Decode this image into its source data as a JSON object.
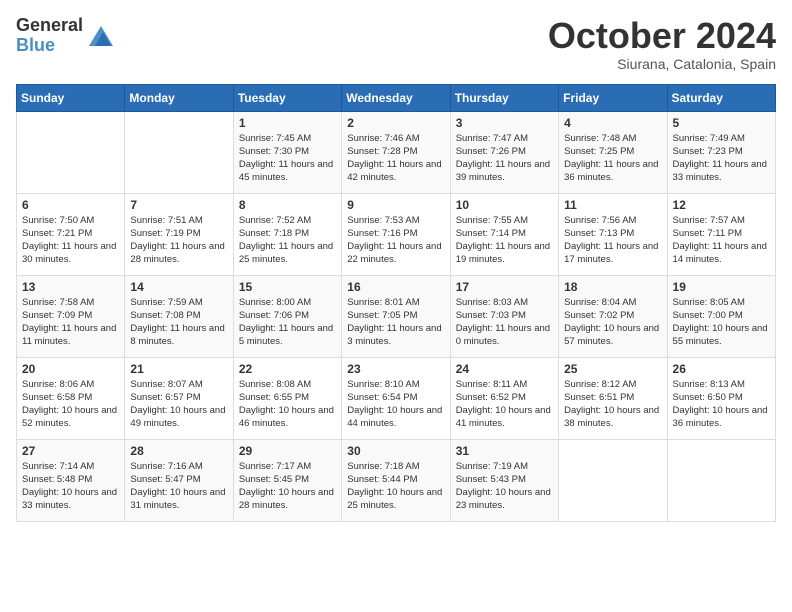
{
  "header": {
    "logo_general": "General",
    "logo_blue": "Blue",
    "month": "October 2024",
    "location": "Siurana, Catalonia, Spain"
  },
  "weekdays": [
    "Sunday",
    "Monday",
    "Tuesday",
    "Wednesday",
    "Thursday",
    "Friday",
    "Saturday"
  ],
  "weeks": [
    [
      {
        "day": "",
        "info": ""
      },
      {
        "day": "",
        "info": ""
      },
      {
        "day": "1",
        "info": "Sunrise: 7:45 AM\nSunset: 7:30 PM\nDaylight: 11 hours and 45 minutes."
      },
      {
        "day": "2",
        "info": "Sunrise: 7:46 AM\nSunset: 7:28 PM\nDaylight: 11 hours and 42 minutes."
      },
      {
        "day": "3",
        "info": "Sunrise: 7:47 AM\nSunset: 7:26 PM\nDaylight: 11 hours and 39 minutes."
      },
      {
        "day": "4",
        "info": "Sunrise: 7:48 AM\nSunset: 7:25 PM\nDaylight: 11 hours and 36 minutes."
      },
      {
        "day": "5",
        "info": "Sunrise: 7:49 AM\nSunset: 7:23 PM\nDaylight: 11 hours and 33 minutes."
      }
    ],
    [
      {
        "day": "6",
        "info": "Sunrise: 7:50 AM\nSunset: 7:21 PM\nDaylight: 11 hours and 30 minutes."
      },
      {
        "day": "7",
        "info": "Sunrise: 7:51 AM\nSunset: 7:19 PM\nDaylight: 11 hours and 28 minutes."
      },
      {
        "day": "8",
        "info": "Sunrise: 7:52 AM\nSunset: 7:18 PM\nDaylight: 11 hours and 25 minutes."
      },
      {
        "day": "9",
        "info": "Sunrise: 7:53 AM\nSunset: 7:16 PM\nDaylight: 11 hours and 22 minutes."
      },
      {
        "day": "10",
        "info": "Sunrise: 7:55 AM\nSunset: 7:14 PM\nDaylight: 11 hours and 19 minutes."
      },
      {
        "day": "11",
        "info": "Sunrise: 7:56 AM\nSunset: 7:13 PM\nDaylight: 11 hours and 17 minutes."
      },
      {
        "day": "12",
        "info": "Sunrise: 7:57 AM\nSunset: 7:11 PM\nDaylight: 11 hours and 14 minutes."
      }
    ],
    [
      {
        "day": "13",
        "info": "Sunrise: 7:58 AM\nSunset: 7:09 PM\nDaylight: 11 hours and 11 minutes."
      },
      {
        "day": "14",
        "info": "Sunrise: 7:59 AM\nSunset: 7:08 PM\nDaylight: 11 hours and 8 minutes."
      },
      {
        "day": "15",
        "info": "Sunrise: 8:00 AM\nSunset: 7:06 PM\nDaylight: 11 hours and 5 minutes."
      },
      {
        "day": "16",
        "info": "Sunrise: 8:01 AM\nSunset: 7:05 PM\nDaylight: 11 hours and 3 minutes."
      },
      {
        "day": "17",
        "info": "Sunrise: 8:03 AM\nSunset: 7:03 PM\nDaylight: 11 hours and 0 minutes."
      },
      {
        "day": "18",
        "info": "Sunrise: 8:04 AM\nSunset: 7:02 PM\nDaylight: 10 hours and 57 minutes."
      },
      {
        "day": "19",
        "info": "Sunrise: 8:05 AM\nSunset: 7:00 PM\nDaylight: 10 hours and 55 minutes."
      }
    ],
    [
      {
        "day": "20",
        "info": "Sunrise: 8:06 AM\nSunset: 6:58 PM\nDaylight: 10 hours and 52 minutes."
      },
      {
        "day": "21",
        "info": "Sunrise: 8:07 AM\nSunset: 6:57 PM\nDaylight: 10 hours and 49 minutes."
      },
      {
        "day": "22",
        "info": "Sunrise: 8:08 AM\nSunset: 6:55 PM\nDaylight: 10 hours and 46 minutes."
      },
      {
        "day": "23",
        "info": "Sunrise: 8:10 AM\nSunset: 6:54 PM\nDaylight: 10 hours and 44 minutes."
      },
      {
        "day": "24",
        "info": "Sunrise: 8:11 AM\nSunset: 6:52 PM\nDaylight: 10 hours and 41 minutes."
      },
      {
        "day": "25",
        "info": "Sunrise: 8:12 AM\nSunset: 6:51 PM\nDaylight: 10 hours and 38 minutes."
      },
      {
        "day": "26",
        "info": "Sunrise: 8:13 AM\nSunset: 6:50 PM\nDaylight: 10 hours and 36 minutes."
      }
    ],
    [
      {
        "day": "27",
        "info": "Sunrise: 7:14 AM\nSunset: 5:48 PM\nDaylight: 10 hours and 33 minutes."
      },
      {
        "day": "28",
        "info": "Sunrise: 7:16 AM\nSunset: 5:47 PM\nDaylight: 10 hours and 31 minutes."
      },
      {
        "day": "29",
        "info": "Sunrise: 7:17 AM\nSunset: 5:45 PM\nDaylight: 10 hours and 28 minutes."
      },
      {
        "day": "30",
        "info": "Sunrise: 7:18 AM\nSunset: 5:44 PM\nDaylight: 10 hours and 25 minutes."
      },
      {
        "day": "31",
        "info": "Sunrise: 7:19 AM\nSunset: 5:43 PM\nDaylight: 10 hours and 23 minutes."
      },
      {
        "day": "",
        "info": ""
      },
      {
        "day": "",
        "info": ""
      }
    ]
  ]
}
